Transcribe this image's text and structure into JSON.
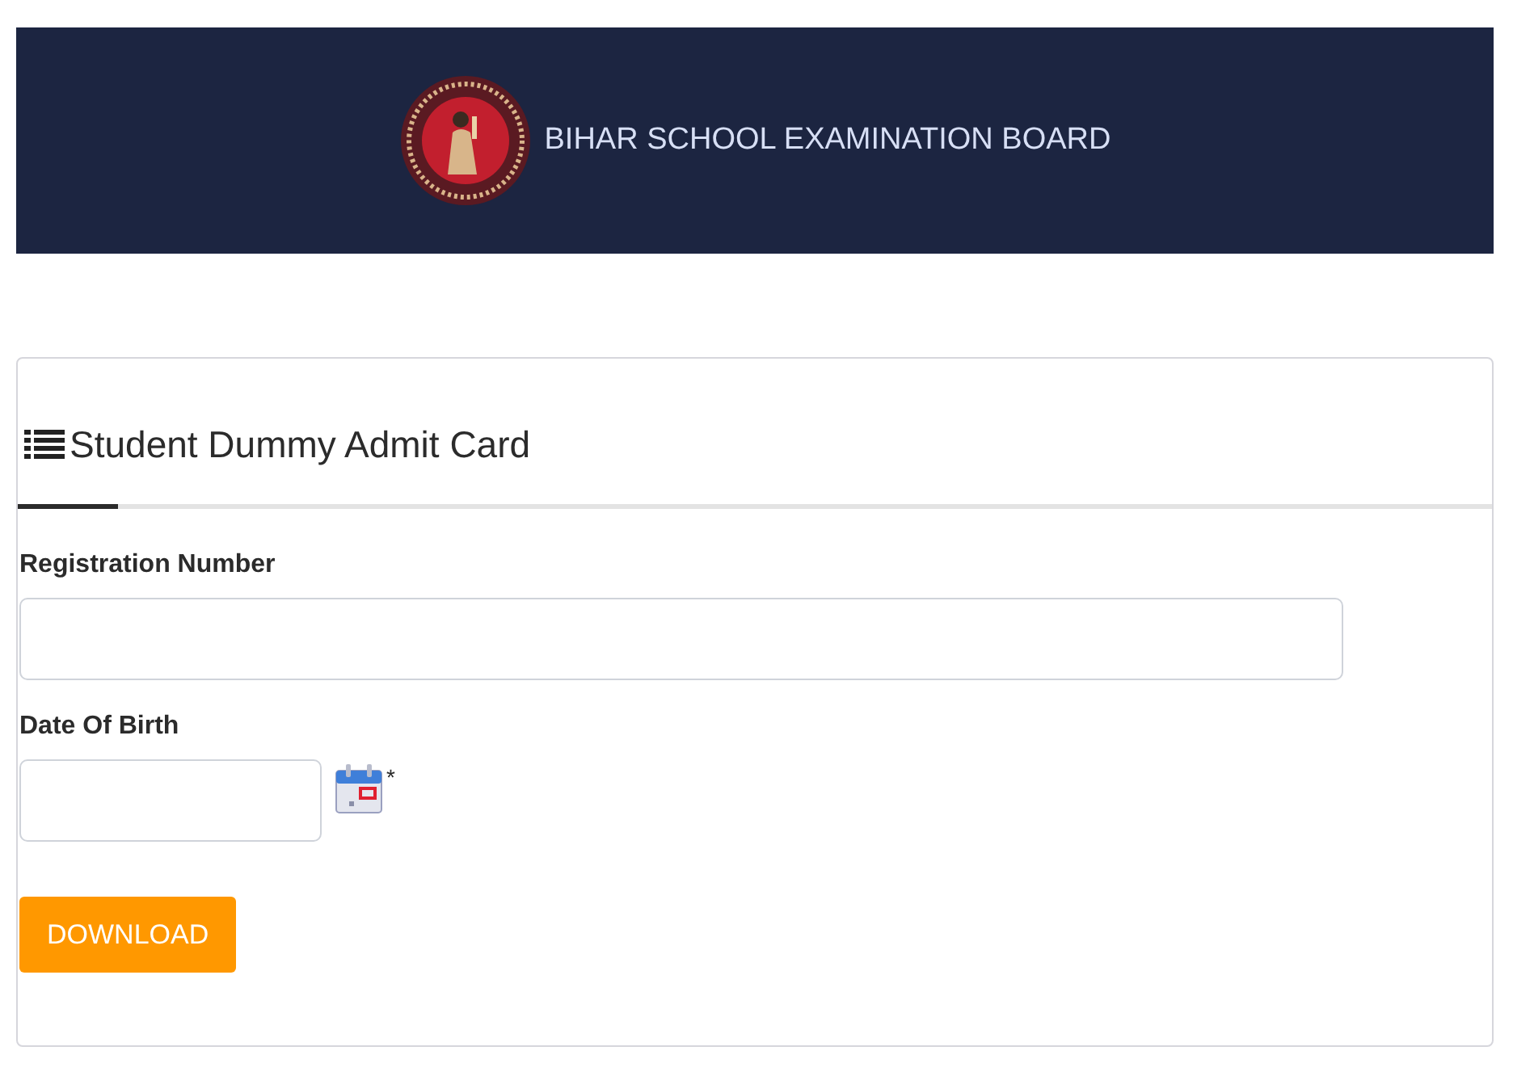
{
  "header": {
    "title": "BIHAR SCHOOL EXAMINATION BOARD"
  },
  "card": {
    "title": "Student Dummy Admit Card",
    "fields": [
      {
        "kind": "text",
        "label": "Registration Number"
      },
      {
        "kind": "date",
        "label": "Date Of Birth",
        "required_mark": "*"
      }
    ],
    "button": "DOWNLOAD"
  }
}
